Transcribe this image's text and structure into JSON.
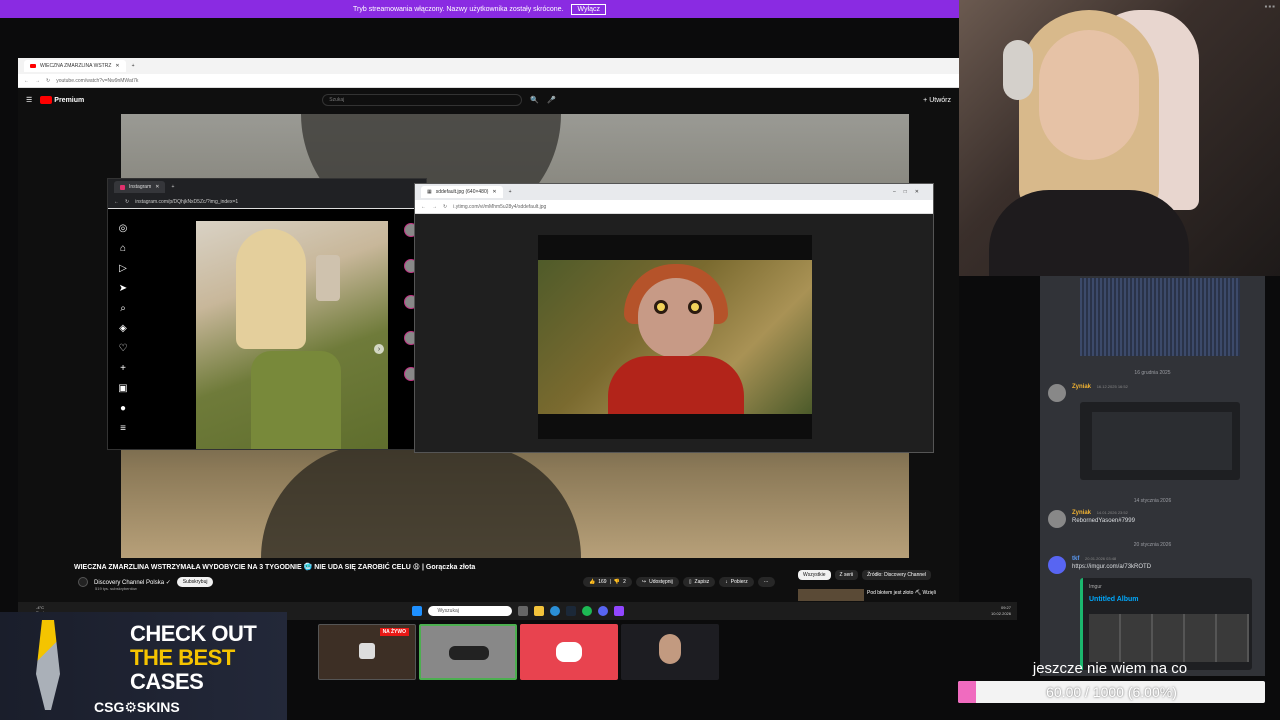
{
  "banner": {
    "text": "Tryb streamowania włączony. Nazwy użytkownika zostały skrócone.",
    "button": "Wyłącz"
  },
  "youtube": {
    "tab_title": "WIECZNA ZMARZLINA WSTRZ",
    "url": "youtube.com/watch?v=Nw9nMWat7k",
    "logo": "Premium",
    "search_placeholder": "Szukaj",
    "create_label": "Utwórz",
    "video_title": "WIECZNA ZMARZLINA WSTRZYMAŁA WYDOBYCIE NA 3 TYGODNIE 🥶 NIE UDA SIĘ ZAROBIĆ CELU 😩 | Gorączka złota",
    "channel_name": "Discovery Channel Polska ✓",
    "subscribers": "519 tys. subskrybentów",
    "subscribe": "Subskrybuj",
    "likes": "169",
    "dislikes": "2",
    "share": "Udostępnij",
    "save": "Zapisz",
    "download": "Pobierz",
    "chips": [
      "Wszystkie",
      "Z serii",
      "Źródło: Discovery Channel"
    ],
    "rec_title": "Pod błotem jest złoto ⛏ Wzięli"
  },
  "instagram": {
    "tab_title": "Instagram",
    "url": "instagram.com/p/DQhjkNxD5Zc/?img_index=1"
  },
  "imageviewer": {
    "tab_title": "sddefault.jpg (640×480)",
    "url": "i.ytimg.com/vi/mMhm5u28y4/sddefault.jpg"
  },
  "taskbar": {
    "weather": "-4°C",
    "weather_desc": "Pochmurno",
    "search": "Wyszukaj",
    "time": "09:27",
    "date": "10.02.2026"
  },
  "chat": {
    "date1": "16 grudnia 2025",
    "msg1_name": "Zyniak",
    "msg1_time": "16.12.2025 16:52",
    "date2": "14 stycznia 2026",
    "msg2_name": "Zyniak",
    "msg2_time": "14.01.2026 23:52",
    "msg2_body": "RebornedYasoen#7999",
    "date3": "20 stycznia 2026",
    "msg3_name": "tkf",
    "msg3_time": "20.01.2026 03:48",
    "msg3_link": "https://imgur.com/a/73kROTD",
    "embed_site": "Imgur",
    "embed_title": "Untitled Album"
  },
  "ad": {
    "line1": "CHECK OUT",
    "line2": "THE BEST",
    "line3": "CASES",
    "brand": "CSG⚙SKINS",
    "line1_color": "#ffffff",
    "line2_color": "#f5c400",
    "line3_color": "#ffffff"
  },
  "thumbs": {
    "live_badge": "NA ŻYWO"
  },
  "goal": {
    "caption": "jeszcze nie wiem na co",
    "progress_text": "60.00 / 1000 (6.00%)",
    "percent": 6
  }
}
